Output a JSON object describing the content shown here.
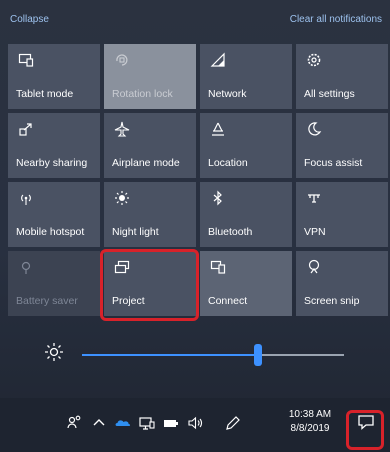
{
  "header": {
    "collapse": "Collapse",
    "clear_all": "Clear all notifications"
  },
  "tiles": [
    {
      "label": "Tablet mode",
      "icon": "tablet-mode-icon"
    },
    {
      "label": "Rotation lock",
      "icon": "rotation-lock-icon"
    },
    {
      "label": "Network",
      "icon": "network-icon"
    },
    {
      "label": "All settings",
      "icon": "gear-icon"
    },
    {
      "label": "Nearby sharing",
      "icon": "nearby-sharing-icon"
    },
    {
      "label": "Airplane mode",
      "icon": "airplane-icon"
    },
    {
      "label": "Location",
      "icon": "location-icon"
    },
    {
      "label": "Focus assist",
      "icon": "moon-icon"
    },
    {
      "label": "Mobile hotspot",
      "icon": "hotspot-icon"
    },
    {
      "label": "Night light",
      "icon": "night-light-icon"
    },
    {
      "label": "Bluetooth",
      "icon": "bluetooth-icon"
    },
    {
      "label": "VPN",
      "icon": "vpn-icon"
    },
    {
      "label": "Battery saver",
      "icon": "battery-saver-icon"
    },
    {
      "label": "Project",
      "icon": "project-icon"
    },
    {
      "label": "Connect",
      "icon": "connect-icon"
    },
    {
      "label": "Screen snip",
      "icon": "screen-snip-icon"
    }
  ],
  "brightness": {
    "value": 0.67,
    "icon": "sun-icon"
  },
  "taskbar": {
    "icons": [
      "people-icon",
      "chevron-up-icon",
      "onedrive-icon",
      "display-icon",
      "battery-icon",
      "volume-icon",
      "pen-icon"
    ],
    "time": "10:38 AM",
    "date": "8/8/2019",
    "action_center_icon": "action-center-icon"
  },
  "colors": {
    "highlight": "#d8222a",
    "accent": "#3d91ff",
    "link": "#9dc2ee"
  }
}
